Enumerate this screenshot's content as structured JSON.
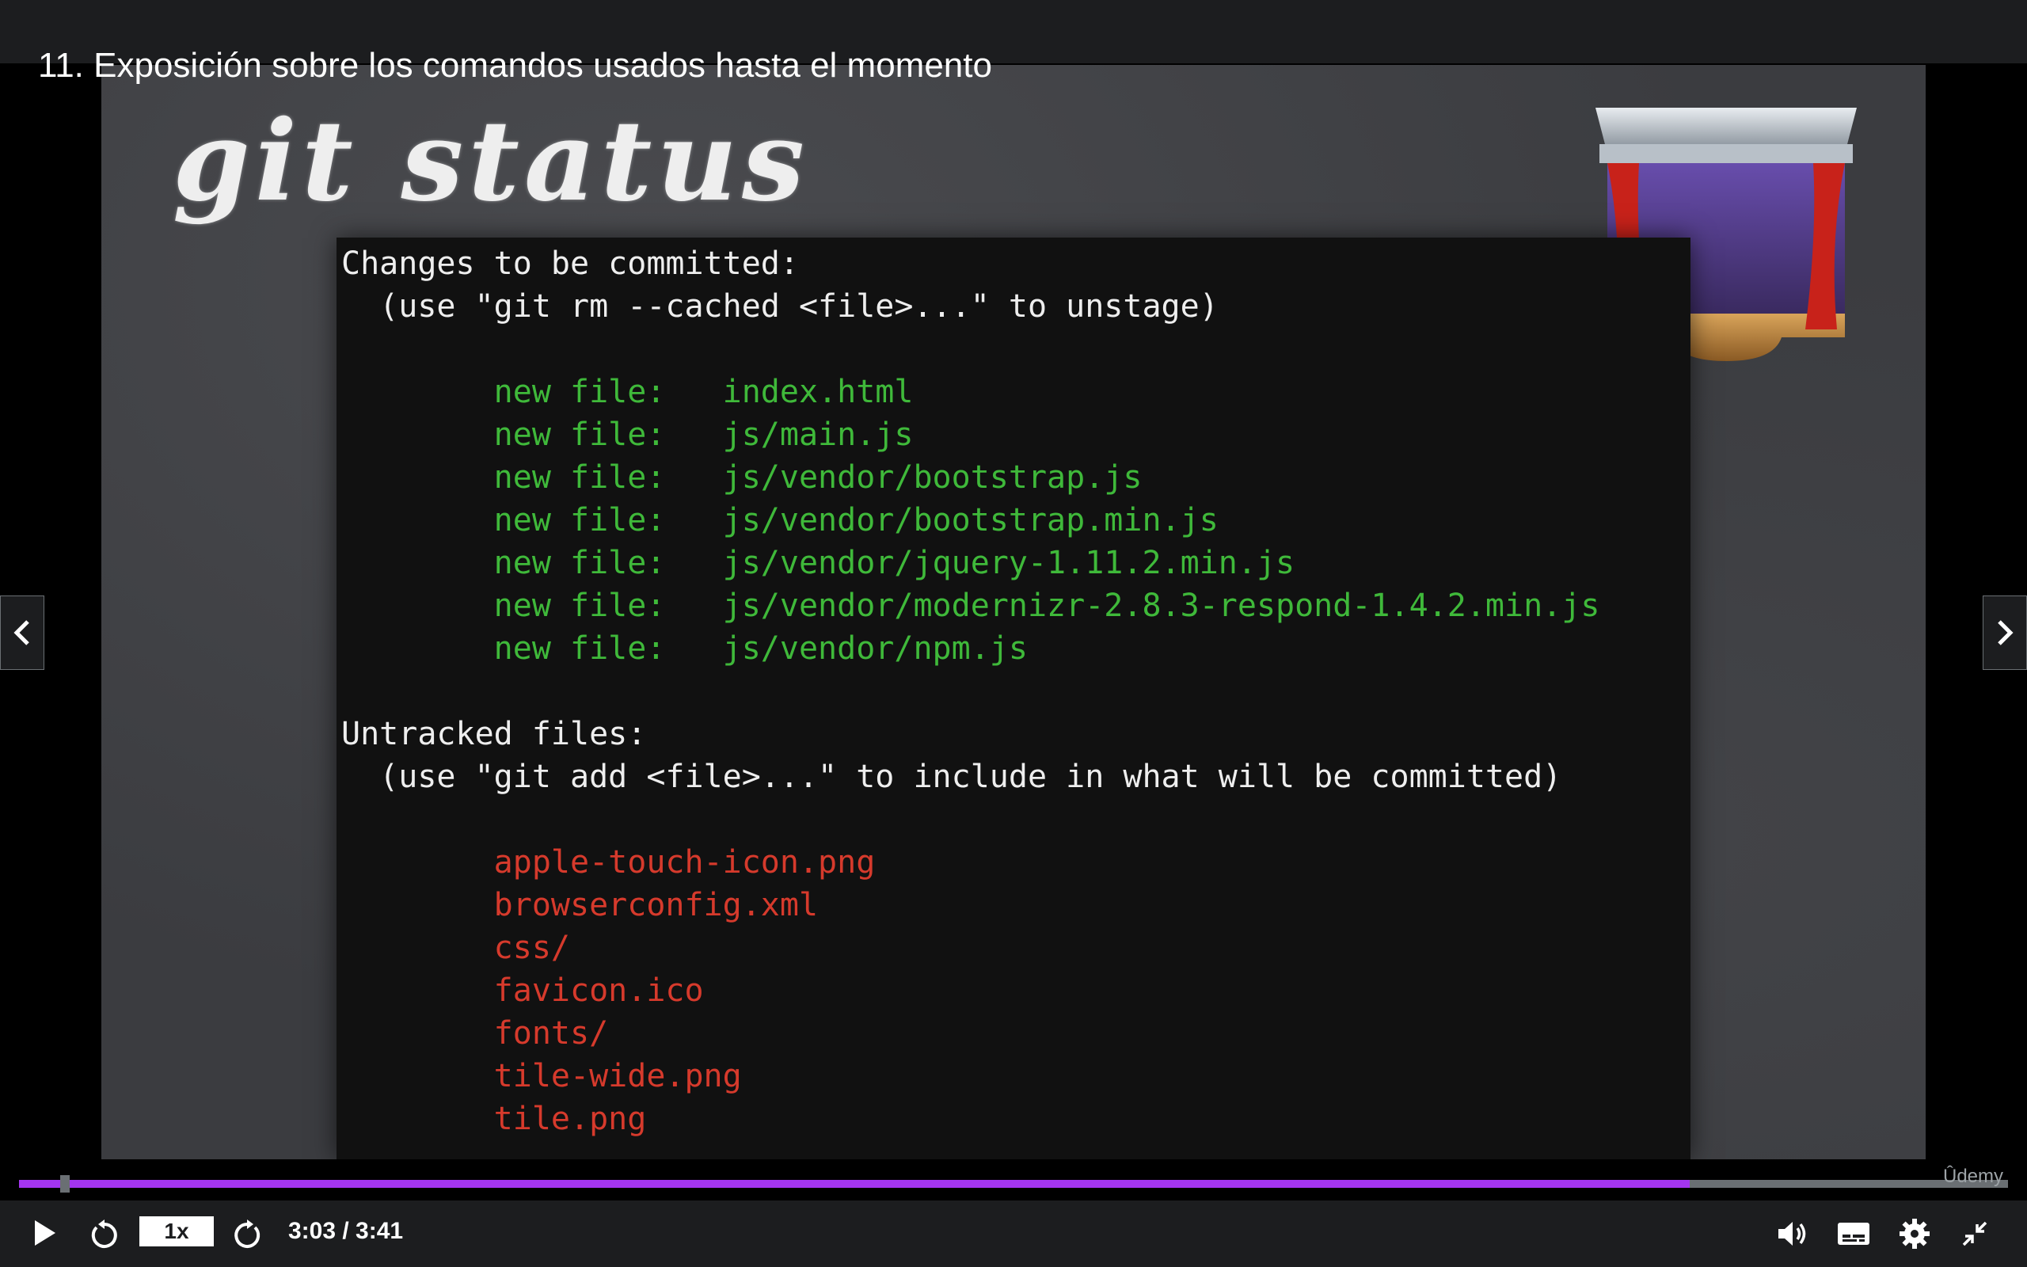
{
  "header": {
    "lecture_title": "11. Exposición sobre los comandos usados hasta el momento"
  },
  "slide": {
    "heading": "git status",
    "terminal": {
      "lines": [
        {
          "text": "Changes to be committed:",
          "color": "white"
        },
        {
          "text": "  (use \"git rm --cached <file>...\" to unstage)",
          "color": "white"
        },
        {
          "text": "",
          "color": "white"
        },
        {
          "text": "        new file:   index.html",
          "color": "green"
        },
        {
          "text": "        new file:   js/main.js",
          "color": "green"
        },
        {
          "text": "        new file:   js/vendor/bootstrap.js",
          "color": "green"
        },
        {
          "text": "        new file:   js/vendor/bootstrap.min.js",
          "color": "green"
        },
        {
          "text": "        new file:   js/vendor/jquery-1.11.2.min.js",
          "color": "green"
        },
        {
          "text": "        new file:   js/vendor/modernizr-2.8.3-respond-1.4.2.min.js",
          "color": "green"
        },
        {
          "text": "        new file:   js/vendor/npm.js",
          "color": "green"
        },
        {
          "text": "",
          "color": "white"
        },
        {
          "text": "Untracked files:",
          "color": "white"
        },
        {
          "text": "  (use \"git add <file>...\" to include in what will be committed)",
          "color": "white"
        },
        {
          "text": "",
          "color": "white"
        },
        {
          "text": "        apple-touch-icon.png",
          "color": "red"
        },
        {
          "text": "        browserconfig.xml",
          "color": "red"
        },
        {
          "text": "        css/",
          "color": "red"
        },
        {
          "text": "        favicon.ico",
          "color": "red"
        },
        {
          "text": "        fonts/",
          "color": "red"
        },
        {
          "text": "        tile-wide.png",
          "color": "red"
        },
        {
          "text": "        tile.png",
          "color": "red"
        }
      ]
    },
    "icon": "theater-stage-icon"
  },
  "navigation": {
    "prev_icon": "chevron-left-icon",
    "next_icon": "chevron-right-icon"
  },
  "player": {
    "progress": 0.84,
    "watermark": "Ûdemy",
    "speed_label": "1x",
    "time_display": "3:03 / 3:41",
    "accent_color": "#a435f0",
    "icons": [
      "play-icon",
      "rewind-icon",
      "forward-icon",
      "volume-icon",
      "captions-icon",
      "settings-icon",
      "exit-fullscreen-icon"
    ]
  }
}
